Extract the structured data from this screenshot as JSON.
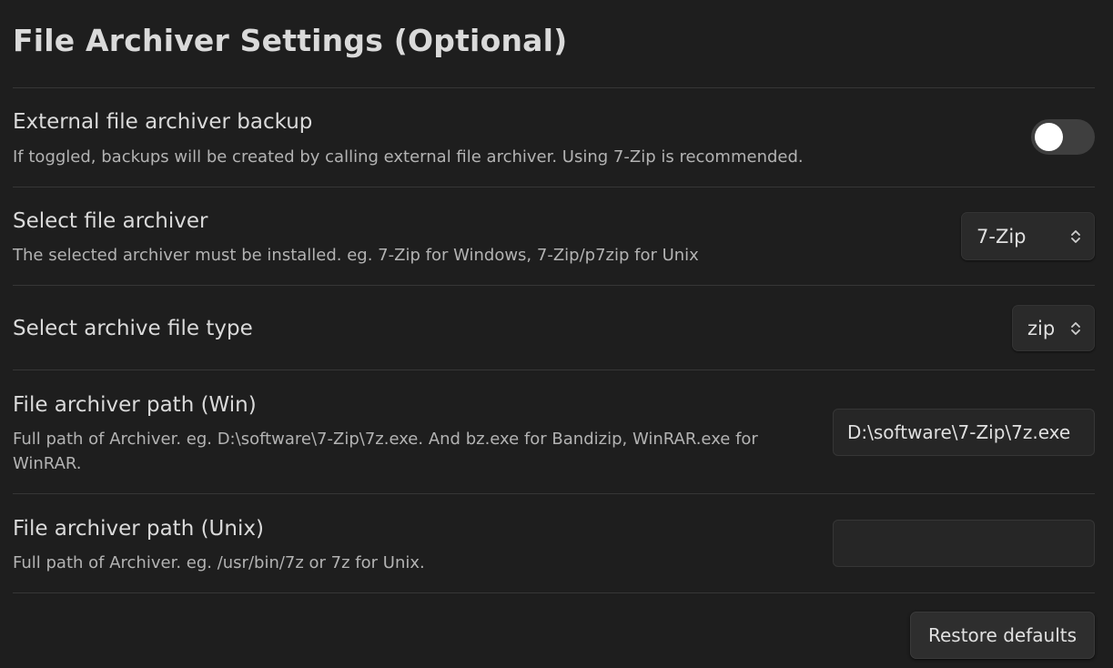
{
  "page": {
    "title": "File Archiver Settings (Optional)"
  },
  "settings": {
    "external_backup": {
      "name": "External file archiver backup",
      "description": "If toggled, backups will be created by calling external file archiver. Using 7-Zip is recommended.",
      "enabled": false
    },
    "select_archiver": {
      "name": "Select file archiver",
      "description": "The selected archiver must be installed. eg. 7-Zip for Windows, 7-Zip/p7zip for Unix",
      "value": "7-Zip"
    },
    "archive_type": {
      "name": "Select archive file type",
      "value": "zip"
    },
    "path_win": {
      "name": "File archiver path (Win)",
      "description": "Full path of Archiver. eg. D:\\software\\7-Zip\\7z.exe. And bz.exe for Bandizip, WinRAR.exe for WinRAR.",
      "value": "D:\\software\\7-Zip\\7z.exe"
    },
    "path_unix": {
      "name": "File archiver path (Unix)",
      "description": "Full path of Archiver. eg. /usr/bin/7z or 7z for Unix.",
      "value": ""
    }
  },
  "footer": {
    "restore_label": "Restore defaults"
  },
  "colors": {
    "background": "#1e1e1e",
    "toggle_off_track": "#3f3f3f",
    "toggle_knob": "#ffffff"
  },
  "icons": {
    "dropdown": "chevron-up-down-icon"
  }
}
